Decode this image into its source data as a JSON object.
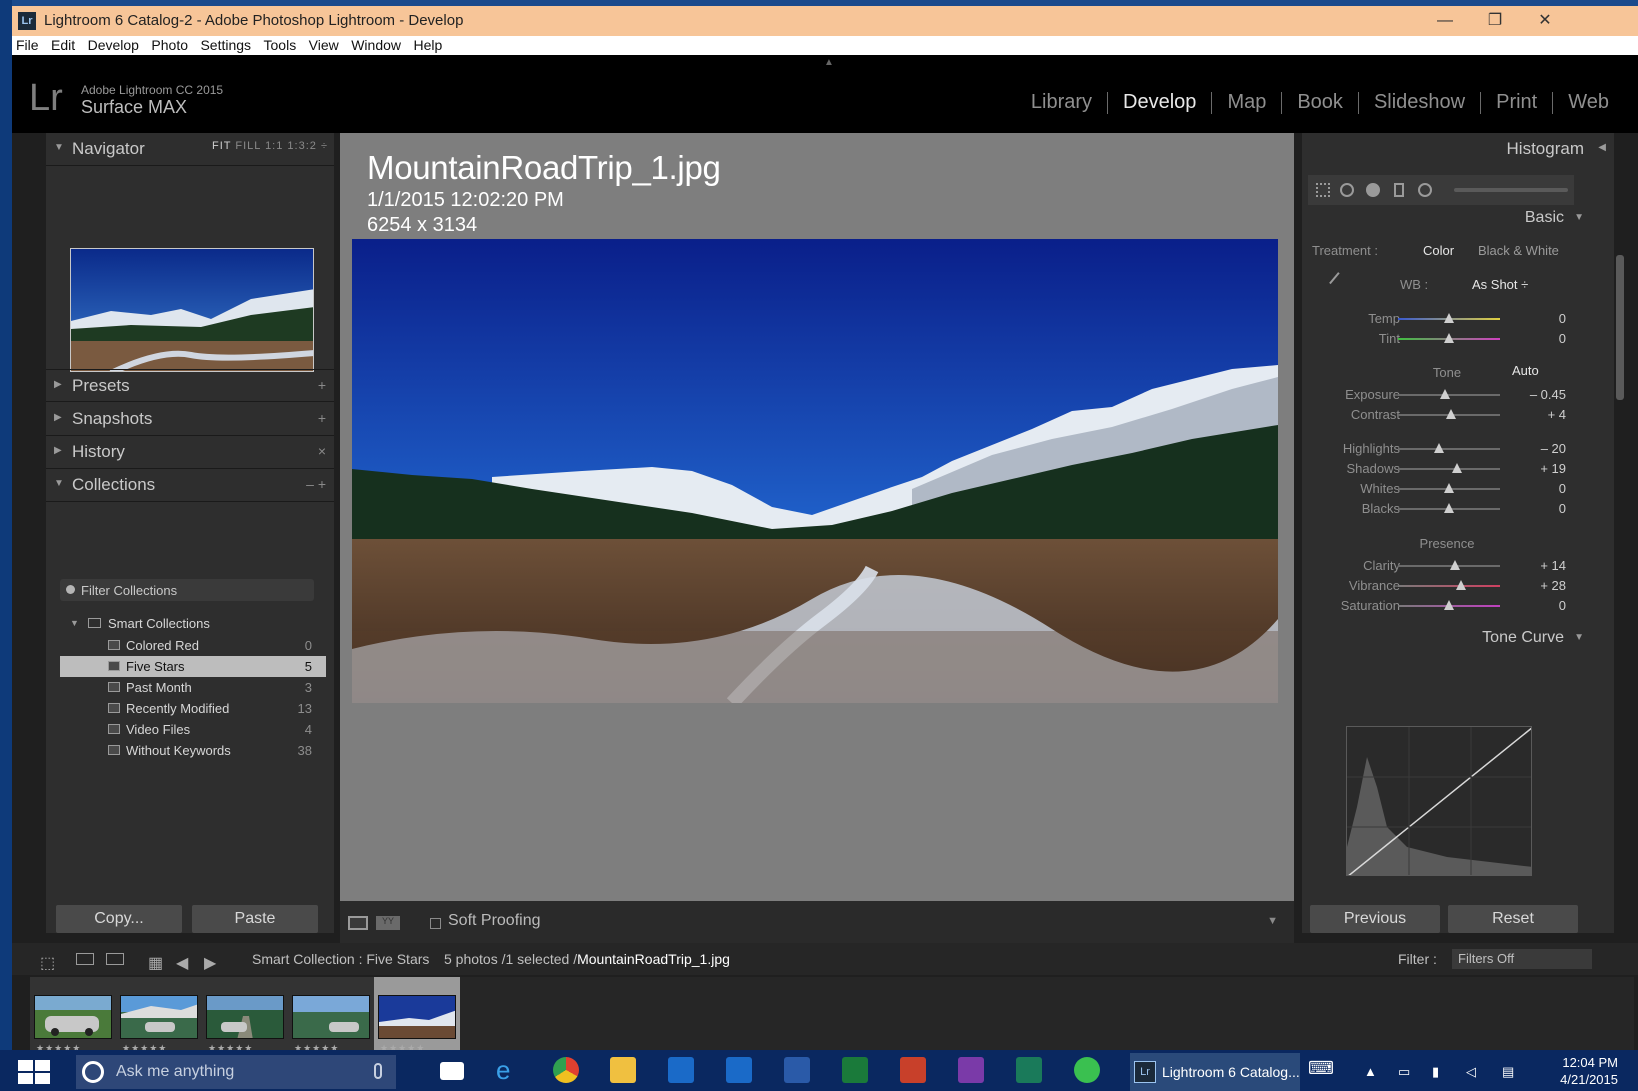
{
  "window": {
    "title": "Lightroom 6 Catalog-2 - Adobe Photoshop Lightroom - Develop",
    "app_icon": "Lr",
    "minimize": "—",
    "restore": "❐",
    "close": "✕"
  },
  "menu": [
    "File",
    "Edit",
    "Develop",
    "Photo",
    "Settings",
    "Tools",
    "View",
    "Window",
    "Help"
  ],
  "identity": {
    "logo": "Lr",
    "product": "Adobe Lightroom CC 2015",
    "name": "Surface MAX"
  },
  "modules": {
    "items": [
      "Library",
      "Develop",
      "Map",
      "Book",
      "Slideshow",
      "Print",
      "Web"
    ],
    "active": "Develop"
  },
  "left": {
    "navigator": {
      "label": "Navigator",
      "zoom": [
        "FIT",
        "FILL",
        "1:1",
        "1:3:2"
      ],
      "zoom_arrow": "÷"
    },
    "presets": {
      "label": "Presets",
      "action": "+"
    },
    "snapshots": {
      "label": "Snapshots",
      "action": "+"
    },
    "history": {
      "label": "History",
      "action": "×"
    },
    "collections": {
      "label": "Collections",
      "action": "– +"
    },
    "filter_label": "Filter Collections",
    "smart_label": "Smart Collections",
    "items": [
      {
        "name": "Colored Red",
        "count": "0"
      },
      {
        "name": "Five Stars",
        "count": "5"
      },
      {
        "name": "Past Month",
        "count": "3"
      },
      {
        "name": "Recently Modified",
        "count": "13"
      },
      {
        "name": "Video Files",
        "count": "4"
      },
      {
        "name": "Without Keywords",
        "count": "38"
      }
    ],
    "copy": "Copy...",
    "paste": "Paste"
  },
  "photo": {
    "filename": "MountainRoadTrip_1.jpg",
    "datetime": "1/1/2015 12:02:20 PM",
    "dims": "6254 x 3134"
  },
  "toolbar": {
    "soft_proofing": "Soft Proofing",
    "views": "YY"
  },
  "right": {
    "histogram": "Histogram",
    "basic": "Basic",
    "treatment_label": "Treatment :",
    "treatment_color": "Color",
    "treatment_bw": "Black & White",
    "wb_label": "WB :",
    "wb_value": "As Shot ÷",
    "tone_group": "Tone",
    "auto": "Auto",
    "presence_group": "Presence",
    "sliders": {
      "temp": {
        "label": "Temp",
        "value": "0"
      },
      "tint": {
        "label": "Tint",
        "value": "0"
      },
      "exposure": {
        "label": "Exposure",
        "value": "– 0.45"
      },
      "contrast": {
        "label": "Contrast",
        "value": "+ 4"
      },
      "highlights": {
        "label": "Highlights",
        "value": "– 20"
      },
      "shadows": {
        "label": "Shadows",
        "value": "+ 19"
      },
      "whites": {
        "label": "Whites",
        "value": "0"
      },
      "blacks": {
        "label": "Blacks",
        "value": "0"
      },
      "clarity": {
        "label": "Clarity",
        "value": "+ 14"
      },
      "vibrance": {
        "label": "Vibrance",
        "value": "+ 28"
      },
      "saturation": {
        "label": "Saturation",
        "value": "0"
      }
    },
    "tone_curve": "Tone Curve",
    "previous": "Previous",
    "reset": "Reset"
  },
  "filmstrip_bar": {
    "source": "Smart Collection : Five Stars",
    "count": "5 photos /1 selected /",
    "file": "MountainRoadTrip_1.jpg",
    "filter_label": "Filter :",
    "filter_value": "Filters Off"
  },
  "thumbs": [
    {
      "stars": "★★★★★",
      "selected": false
    },
    {
      "stars": "★★★★★",
      "selected": false
    },
    {
      "stars": "★★★★★",
      "selected": false
    },
    {
      "stars": "★★★★★",
      "selected": false
    },
    {
      "stars": "★★★★★",
      "selected": true
    }
  ],
  "taskbar": {
    "search": "Ask me anything",
    "lr_task": "Lightroom 6 Catalog...",
    "time": "12:04 PM",
    "date": "4/21/2015"
  },
  "colors": {
    "accent_title": "#f7c598",
    "lr_bg": "#1f1f1f",
    "panel": "#2e2e2e",
    "taskbar": "#0a2860"
  }
}
